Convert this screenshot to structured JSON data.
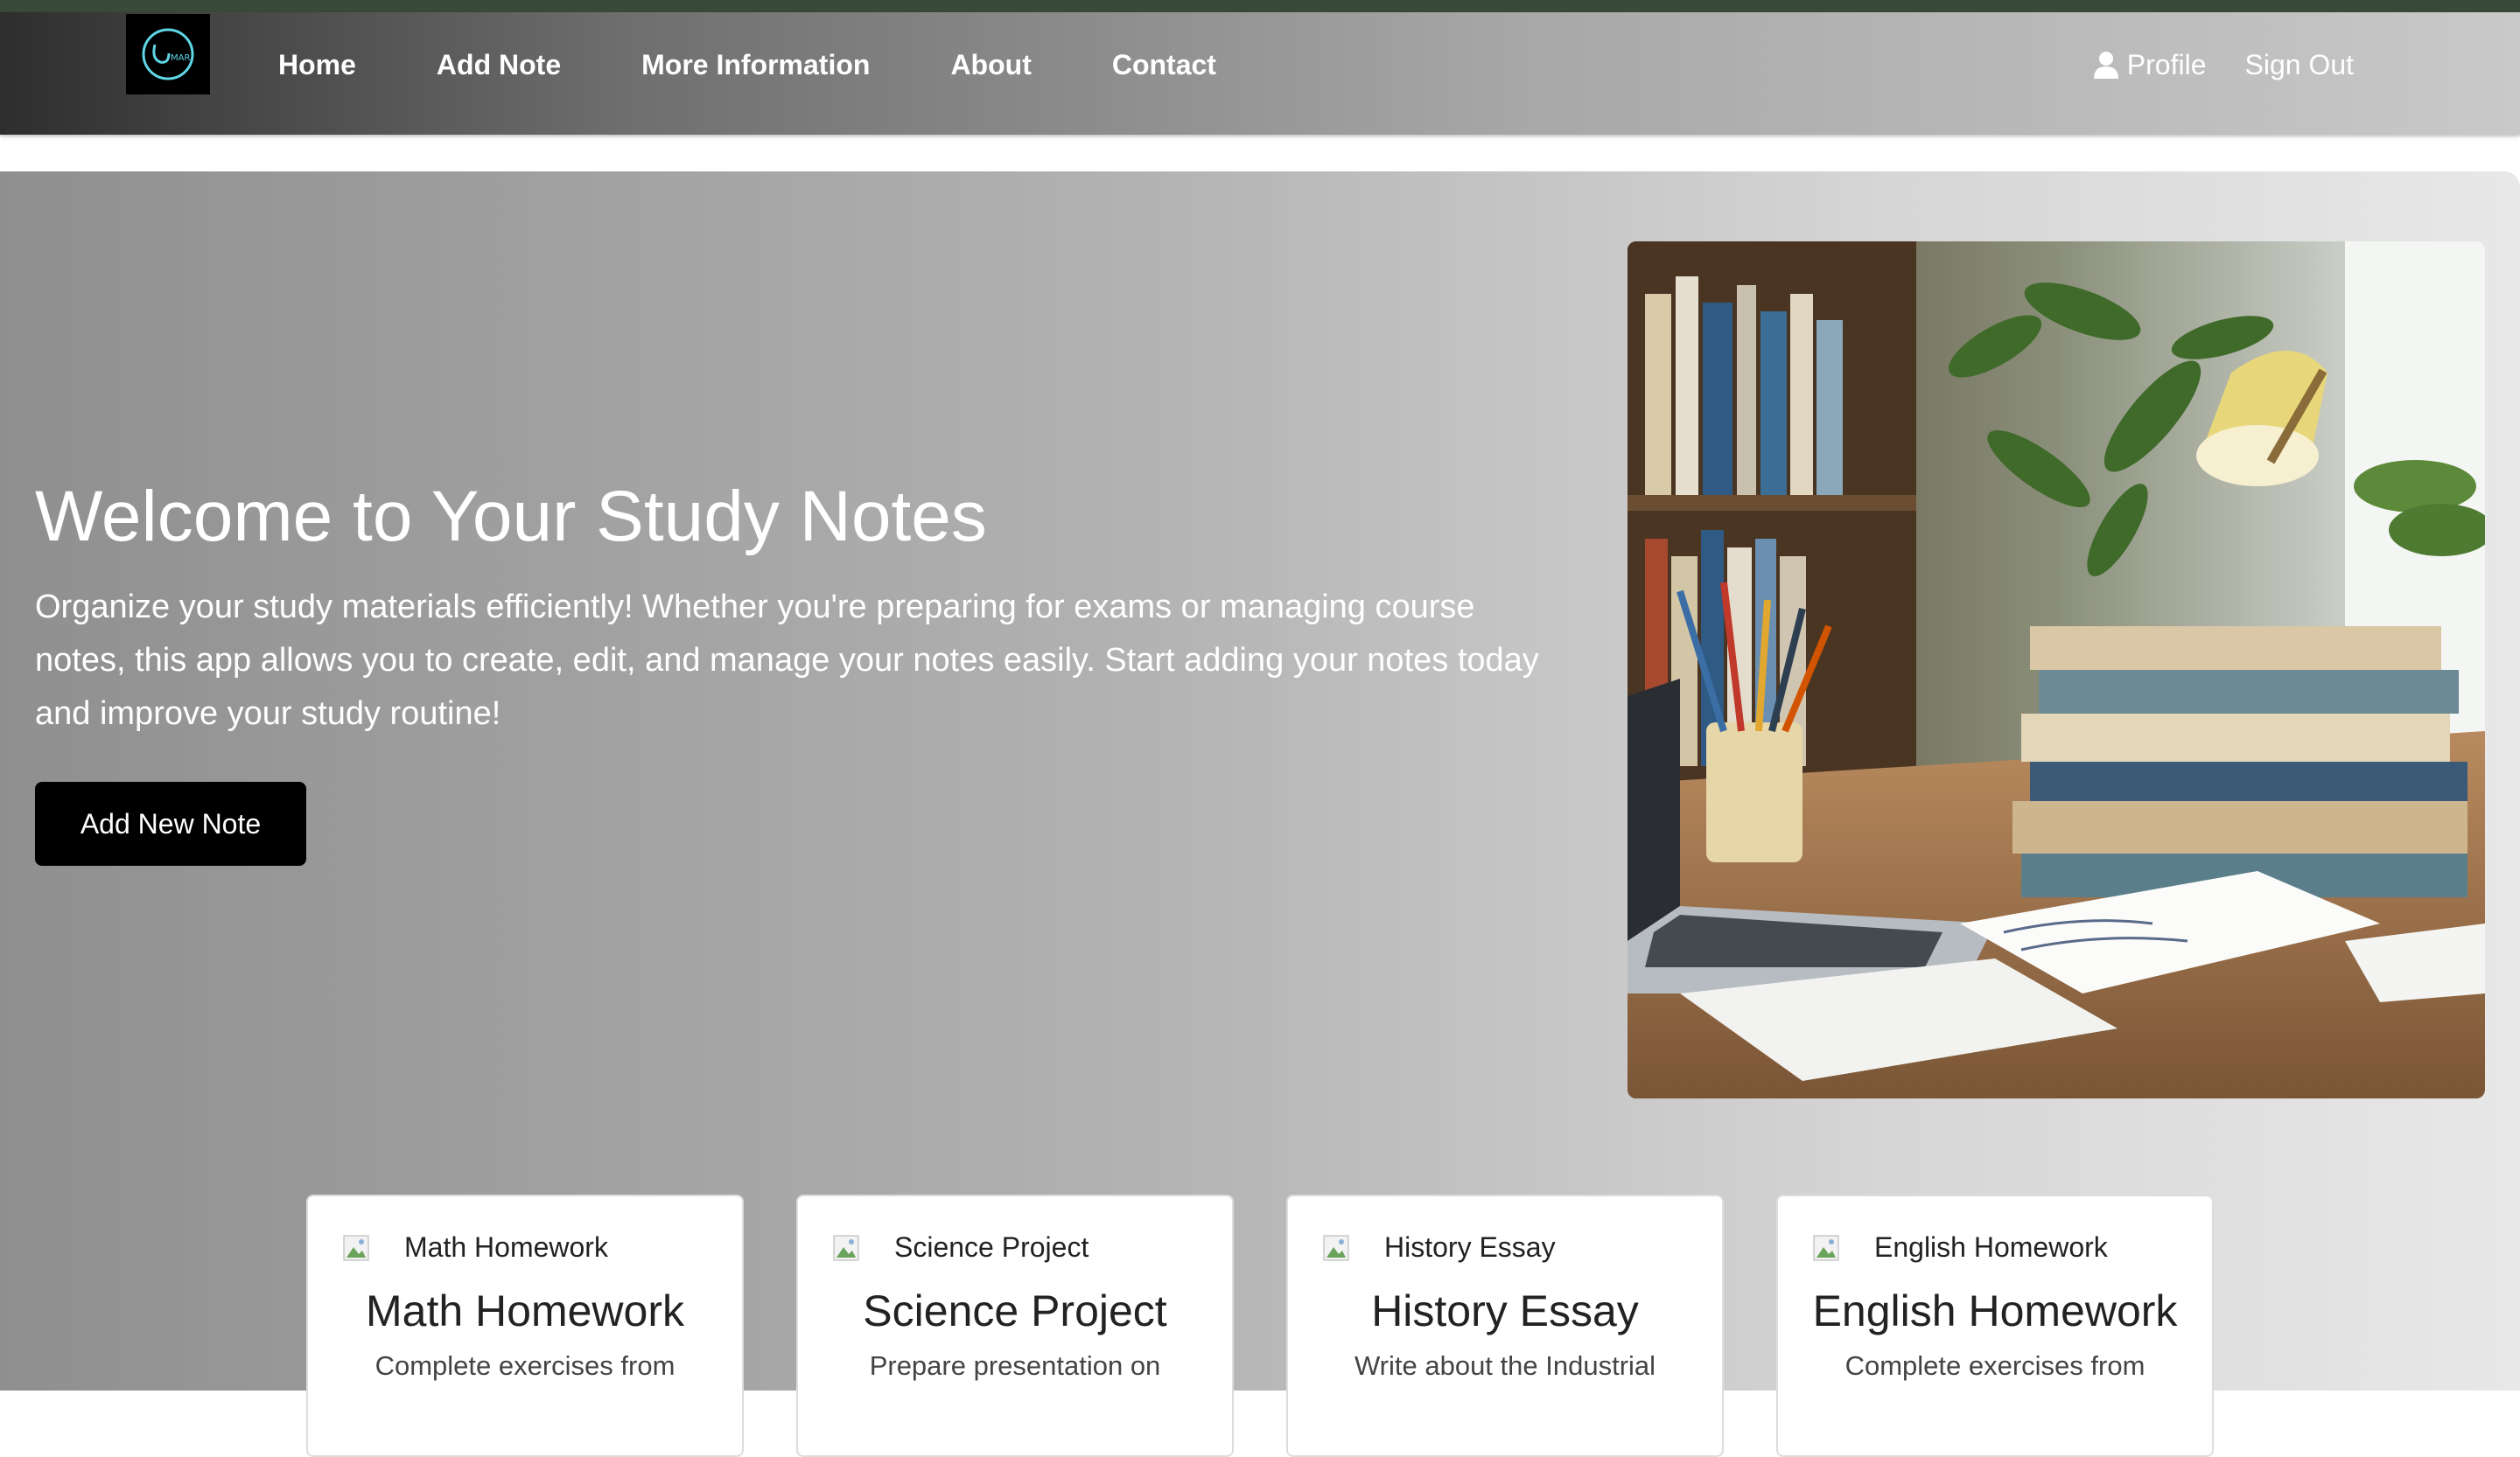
{
  "nav": {
    "links": [
      "Home",
      "Add Note",
      "More Information",
      "About",
      "Contact"
    ],
    "profile": "Profile",
    "signout": "Sign Out"
  },
  "hero": {
    "title": "Welcome to Your Study Notes",
    "text": "Organize your study materials efficiently! Whether you're preparing for exams or managing course notes, this app allows you to create, edit, and manage your notes easily. Start adding your notes today and improve your study routine!",
    "button": "Add New Note"
  },
  "cards": [
    {
      "img_alt": "Math Homework",
      "title": "Math Homework",
      "desc": "Complete exercises from"
    },
    {
      "img_alt": "Science Project",
      "title": "Science Project",
      "desc": "Prepare presentation on"
    },
    {
      "img_alt": "History Essay",
      "title": "History Essay",
      "desc": "Write about the Industrial"
    },
    {
      "img_alt": "English Homework",
      "title": "English Homework",
      "desc": "Complete exercises from"
    }
  ],
  "icons": {
    "logo": "logo-icon",
    "profile": "person-icon",
    "broken_image": "broken-image-icon"
  },
  "colors": {
    "button": "#000000",
    "logo_accent": "#5fd6e6"
  }
}
